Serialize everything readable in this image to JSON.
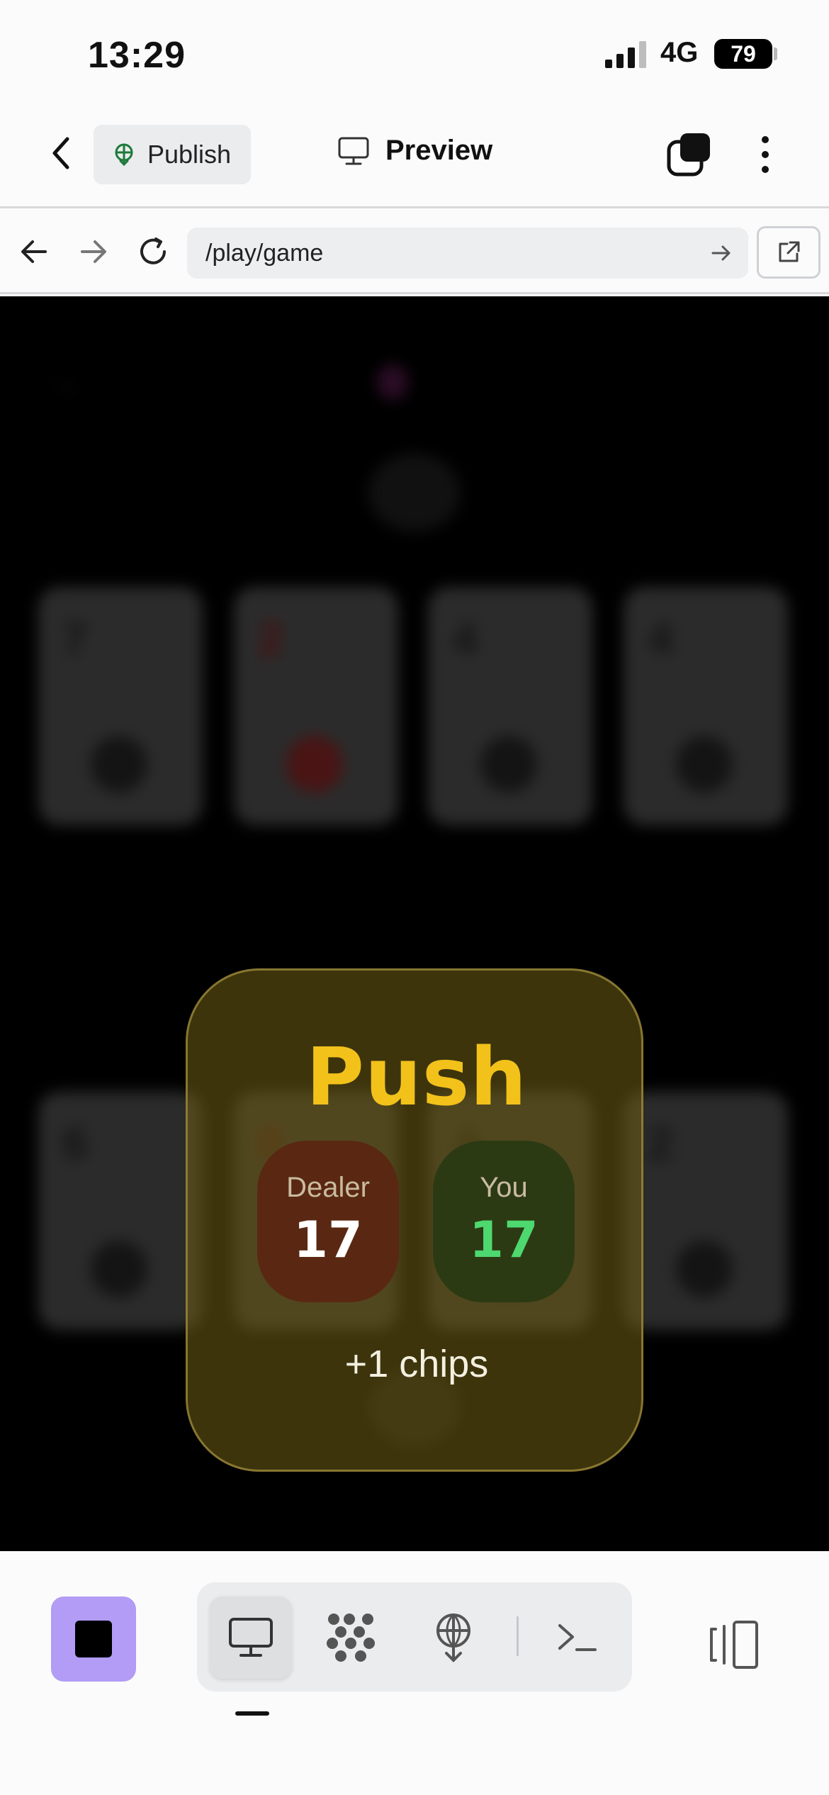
{
  "status_bar": {
    "time": "13:29",
    "network": "4G",
    "battery": "79"
  },
  "header": {
    "publish_label": "Publish",
    "preview_label": "Preview"
  },
  "browser": {
    "url": "/play/game"
  },
  "game": {
    "dealer_cards": [
      {
        "rank": "7",
        "color": "black"
      },
      {
        "rank": "2",
        "color": "red"
      },
      {
        "rank": "4",
        "color": "black"
      },
      {
        "rank": "4",
        "color": "black"
      }
    ],
    "player_cards": [
      {
        "rank": "6",
        "color": "black"
      },
      {
        "rank": "8",
        "color": "red"
      },
      {
        "rank": "A",
        "color": "black"
      },
      {
        "rank": "2",
        "color": "black"
      }
    ],
    "result": {
      "title": "Push",
      "dealer_label": "Dealer",
      "dealer_score": "17",
      "you_label": "You",
      "you_score": "17",
      "chips_text": "+1 chips"
    }
  },
  "colors": {
    "accent": "#b29cf5",
    "result_title": "#f2c21a",
    "player_score": "#4ed870"
  },
  "toolbar": {
    "icons": [
      "stop-icon",
      "monitor-icon",
      "scatter-icon",
      "publish-icon",
      "terminal-icon",
      "panel-icon"
    ],
    "active": "monitor-icon"
  }
}
